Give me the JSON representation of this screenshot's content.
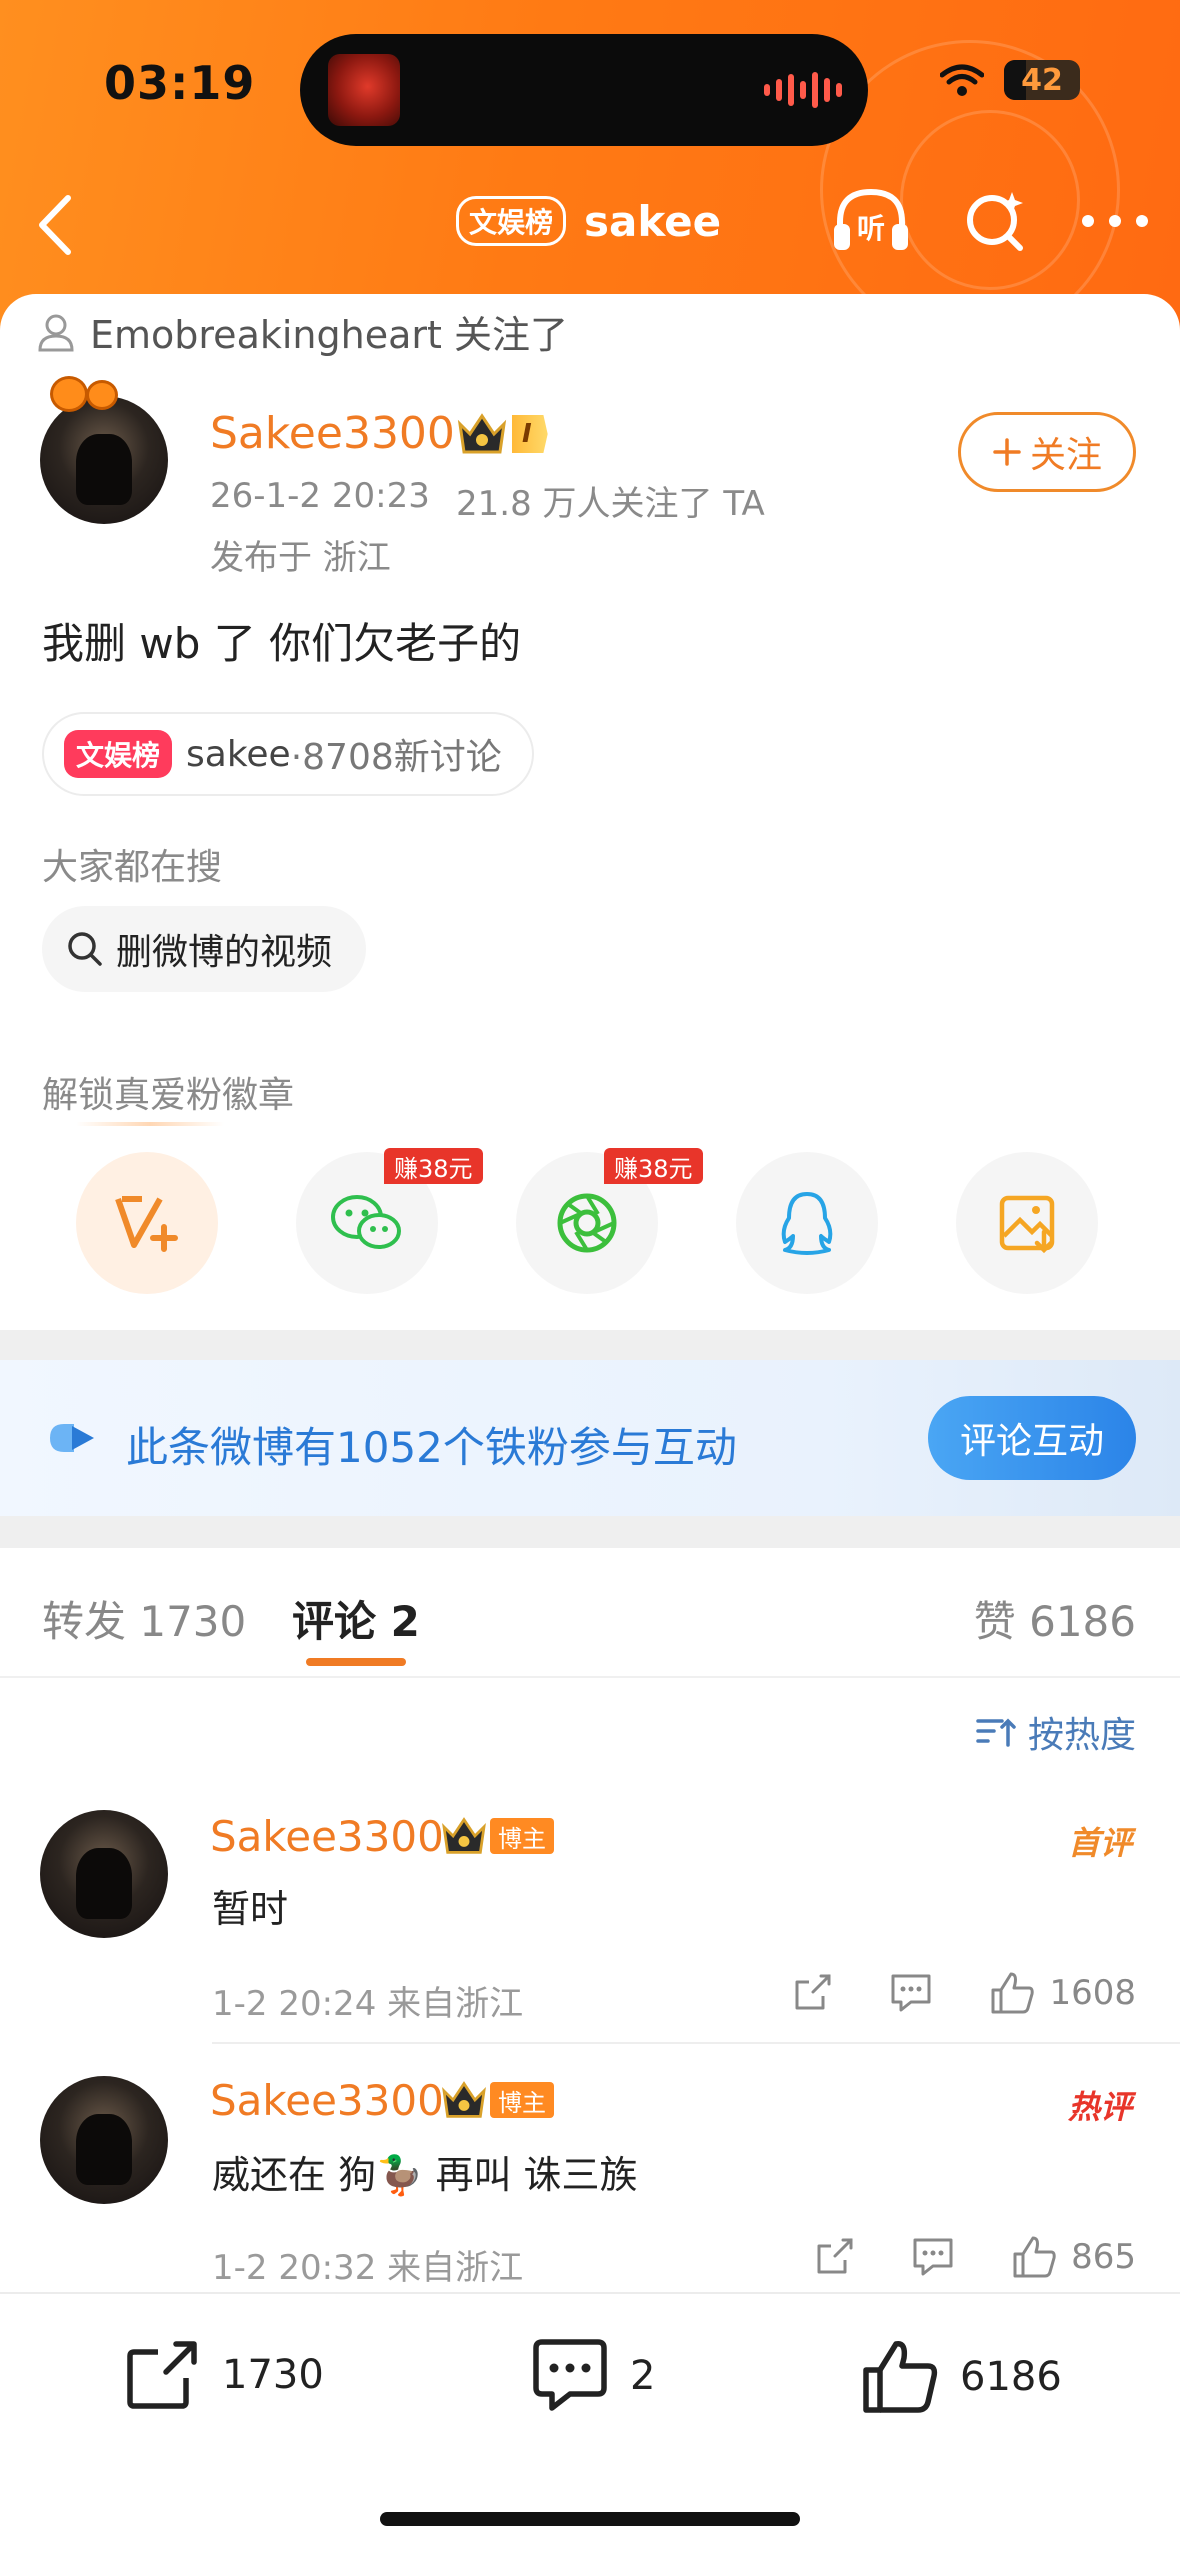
{
  "status": {
    "time": "03:19",
    "battery": "42"
  },
  "nav": {
    "chip": "文娱榜",
    "title": "sakee",
    "listen_icon": "headphones-icon",
    "search_icon": "search-icon",
    "more_icon": "more-icon"
  },
  "follow_note": {
    "text": "Emobreakingheart 关注了"
  },
  "post": {
    "author": "Sakee3300",
    "vip_level": "I",
    "date": "26-1-2 20:23",
    "followers": "21.8 万人关注了 TA",
    "location": "发布于 浙江",
    "follow_label": "关注",
    "text": "我删 wb 了 你们欠老子的",
    "topic_chip": "文娱榜",
    "topic_name": "sakee",
    "topic_count": "·8708新讨论"
  },
  "search": {
    "label": "大家都在搜",
    "query": "删微博的视频"
  },
  "unlock": {
    "label": "解锁真爱粉徽章",
    "items": [
      {
        "icon": "v-plus-icon"
      },
      {
        "icon": "wechat-icon",
        "earn": "赚38元"
      },
      {
        "icon": "moments-icon",
        "earn": "赚38元"
      },
      {
        "icon": "qq-icon"
      },
      {
        "icon": "save-image-icon"
      }
    ]
  },
  "fans_banner": {
    "text": "此条微博有1052个铁粉参与互动",
    "button": "评论互动"
  },
  "tabs": {
    "repost": "转发 1730",
    "comment": "评论 2",
    "like": "赞 6186"
  },
  "sort": {
    "label": "按热度"
  },
  "comments": [
    {
      "author": "Sakee3300",
      "tag": "博主",
      "rank": "首评",
      "text": "暂时",
      "meta": "1-2 20:24  来自浙江",
      "likes": "1608",
      "rank_color": "#f08a2a"
    },
    {
      "author": "Sakee3300",
      "tag": "博主",
      "rank": "热评",
      "text": "威还在 狗🦆 再叫 诛三族",
      "meta": "1-2 20:32  来自浙江",
      "likes": "865",
      "rank_color": "#e8352a"
    }
  ],
  "bottom_bar": {
    "repost": "1730",
    "comment": "2",
    "like": "6186"
  },
  "colors": {
    "brand_orange": "#ff7a14",
    "name_orange": "#f07b24",
    "link_blue": "#2a7ad6"
  }
}
